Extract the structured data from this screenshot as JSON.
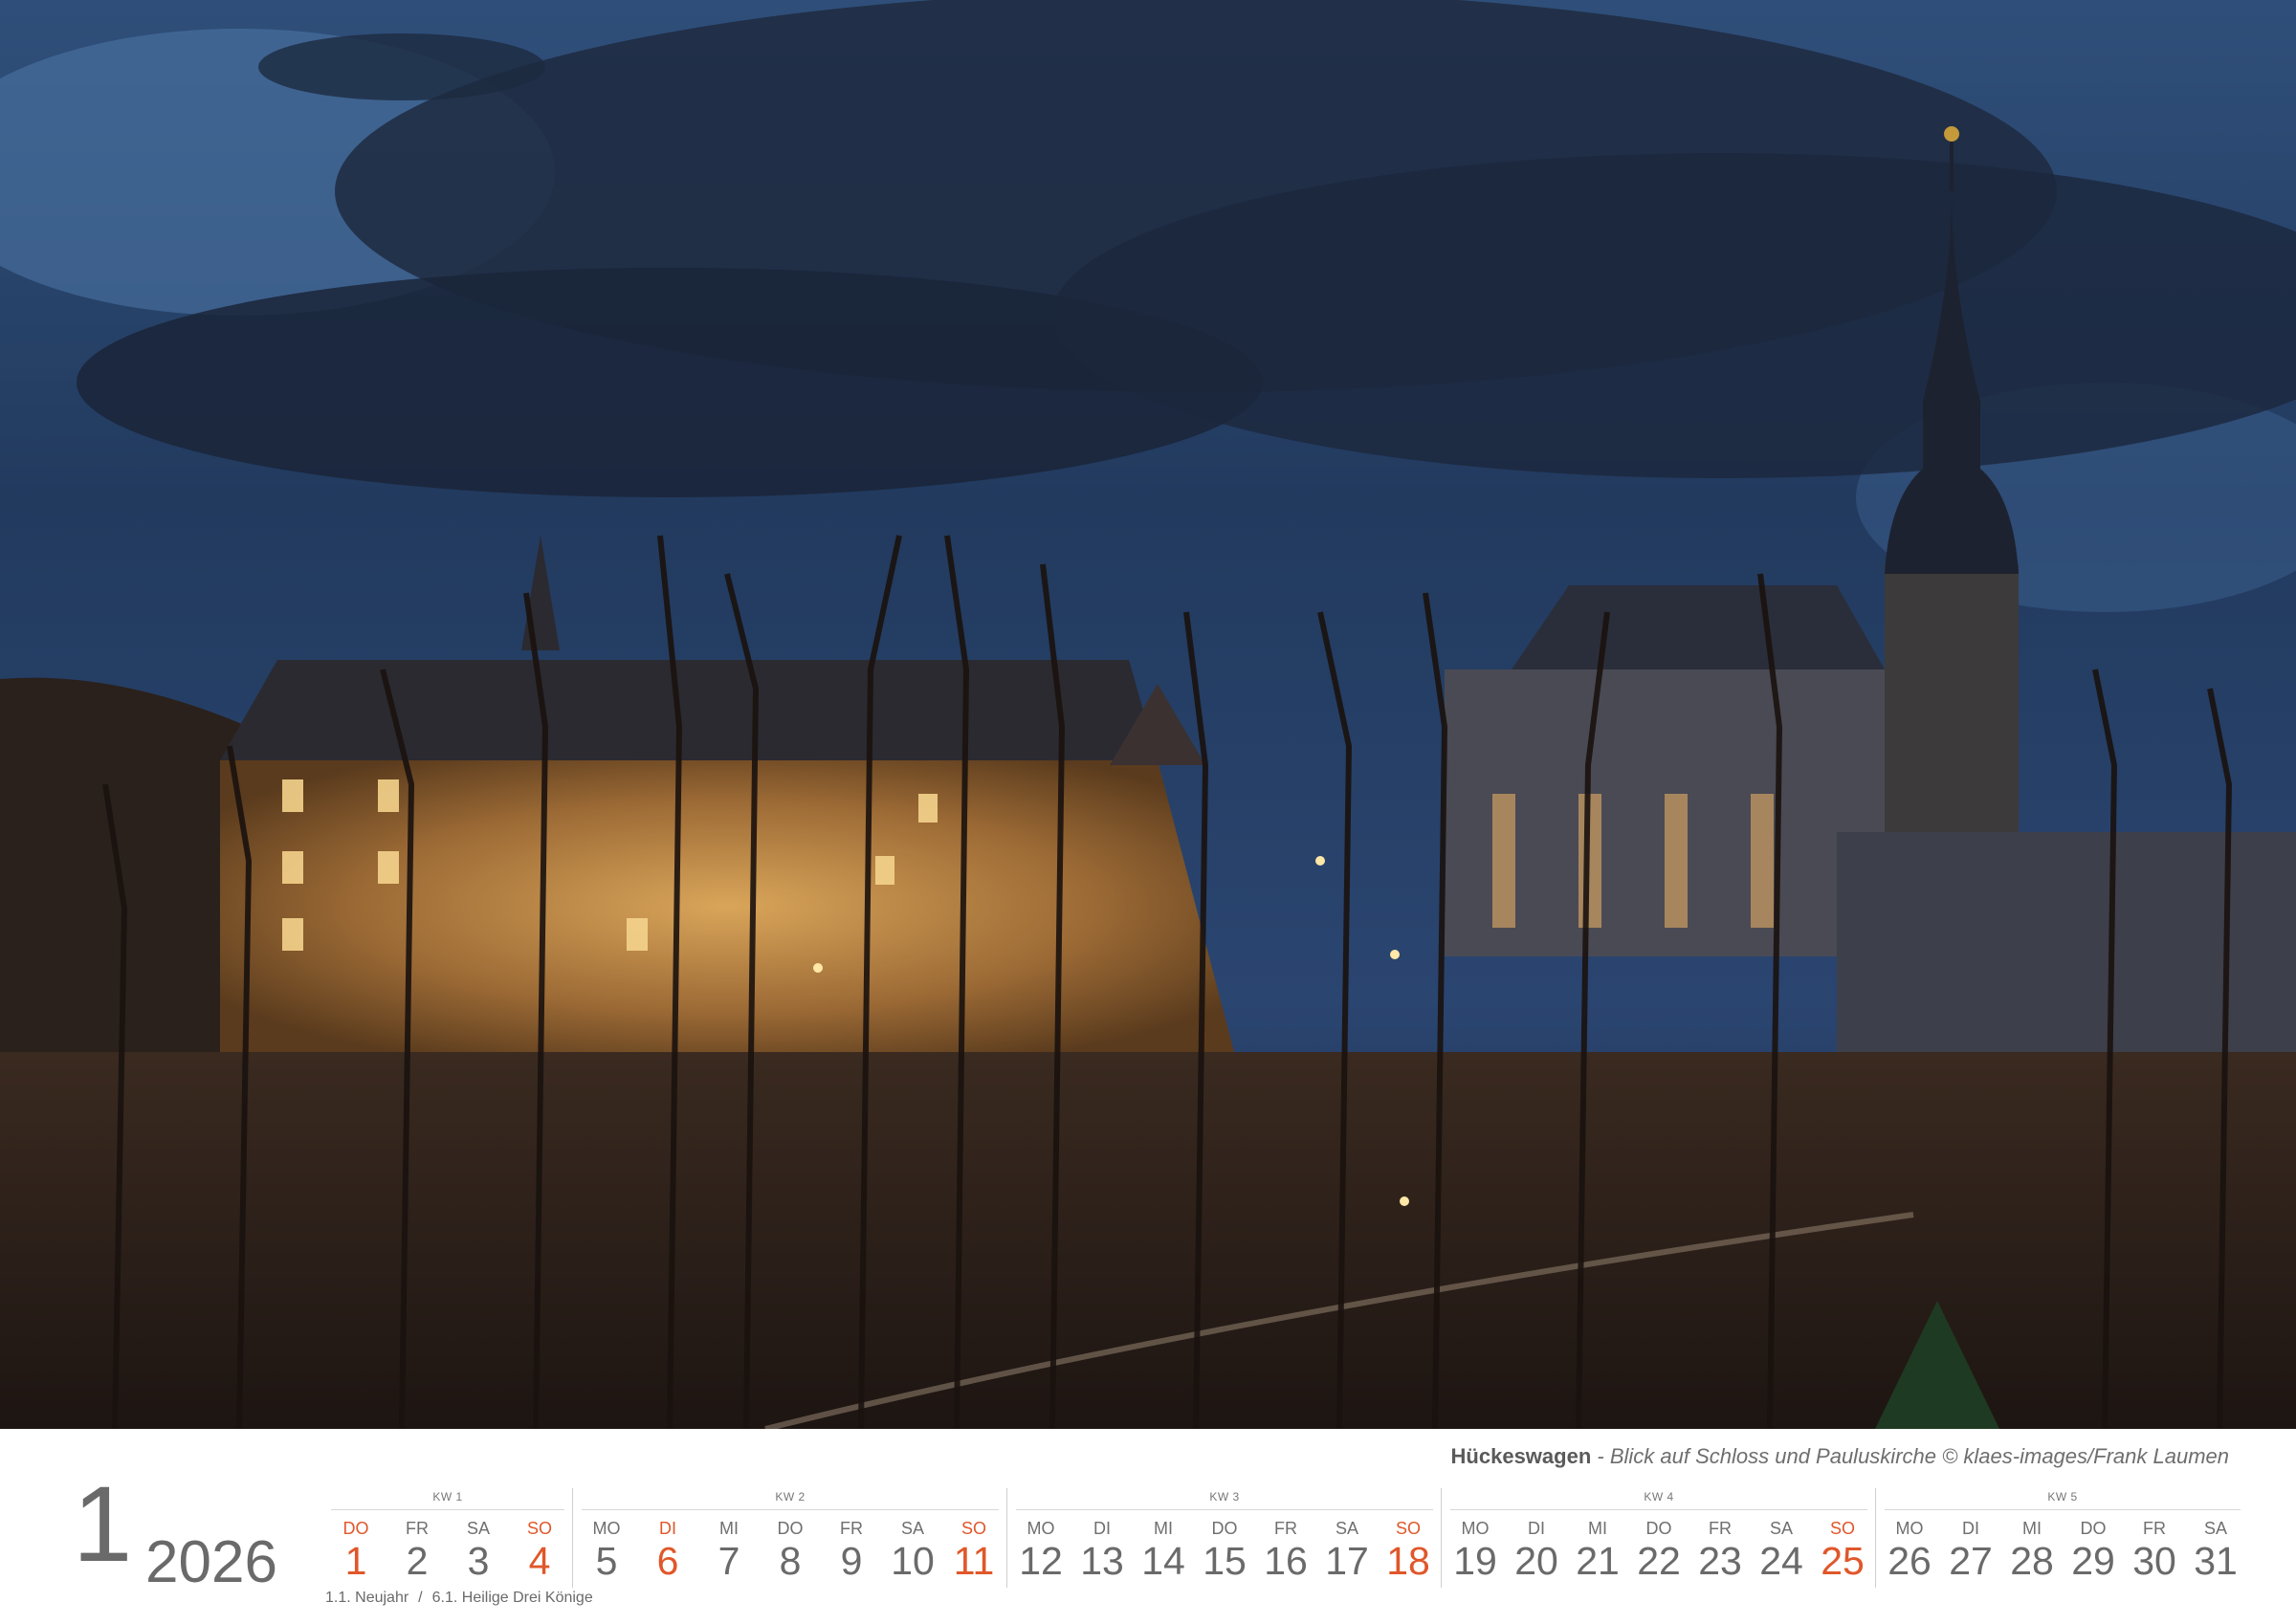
{
  "caption": {
    "place": "Hückeswagen",
    "description": " - Blick auf Schloss und Pauluskirche © klaes-images/Frank Laumen"
  },
  "month_number": "1",
  "year": "2026",
  "weeks": [
    {
      "label": "KW 1",
      "days": [
        {
          "name": "DO",
          "num": "1",
          "holiday": true
        },
        {
          "name": "FR",
          "num": "2"
        },
        {
          "name": "SA",
          "num": "3"
        },
        {
          "name": "SO",
          "num": "4",
          "sunday": true
        }
      ]
    },
    {
      "label": "KW 2",
      "days": [
        {
          "name": "MO",
          "num": "5"
        },
        {
          "name": "DI",
          "num": "6",
          "holiday": true
        },
        {
          "name": "MI",
          "num": "7"
        },
        {
          "name": "DO",
          "num": "8"
        },
        {
          "name": "FR",
          "num": "9"
        },
        {
          "name": "SA",
          "num": "10"
        },
        {
          "name": "SO",
          "num": "11",
          "sunday": true
        }
      ]
    },
    {
      "label": "KW 3",
      "days": [
        {
          "name": "MO",
          "num": "12"
        },
        {
          "name": "DI",
          "num": "13"
        },
        {
          "name": "MI",
          "num": "14"
        },
        {
          "name": "DO",
          "num": "15"
        },
        {
          "name": "FR",
          "num": "16"
        },
        {
          "name": "SA",
          "num": "17"
        },
        {
          "name": "SO",
          "num": "18",
          "sunday": true
        }
      ]
    },
    {
      "label": "KW 4",
      "days": [
        {
          "name": "MO",
          "num": "19"
        },
        {
          "name": "DI",
          "num": "20"
        },
        {
          "name": "MI",
          "num": "21"
        },
        {
          "name": "DO",
          "num": "22"
        },
        {
          "name": "FR",
          "num": "23"
        },
        {
          "name": "SA",
          "num": "24"
        },
        {
          "name": "SO",
          "num": "25",
          "sunday": true
        }
      ]
    },
    {
      "label": "KW 5",
      "days": [
        {
          "name": "MO",
          "num": "26"
        },
        {
          "name": "DI",
          "num": "27"
        },
        {
          "name": "MI",
          "num": "28"
        },
        {
          "name": "DO",
          "num": "29"
        },
        {
          "name": "FR",
          "num": "30"
        },
        {
          "name": "SA",
          "num": "31"
        }
      ]
    }
  ],
  "holidays": [
    "1.1. Neujahr",
    "6.1. Heilige Drei Könige"
  ],
  "holiday_separator": "/",
  "colors": {
    "sunday": "#e0572a",
    "text": "#6a6a6a"
  }
}
